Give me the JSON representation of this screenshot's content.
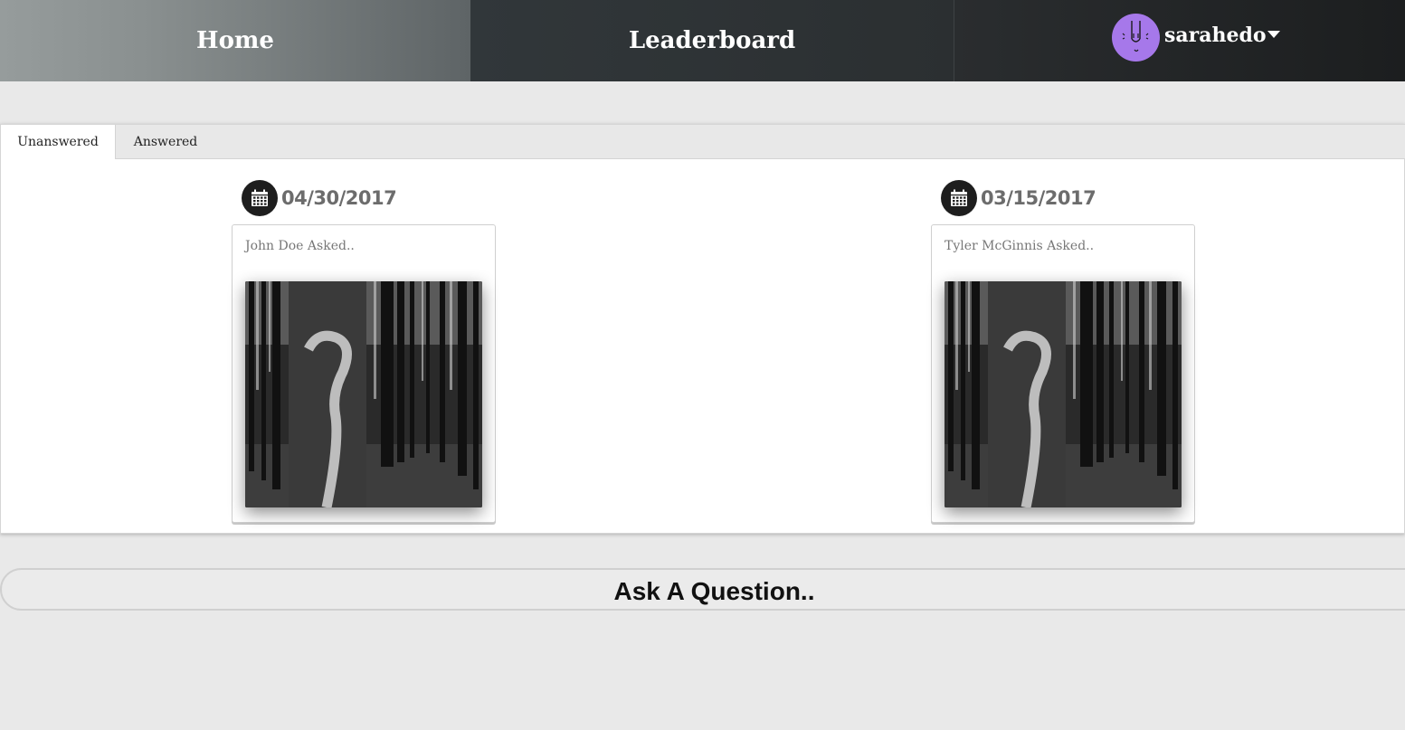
{
  "nav": {
    "home_label": "Home",
    "leaderboard_label": "Leaderboard",
    "username": "sarahedo"
  },
  "tabs": {
    "unanswered_label": "Unanswered",
    "answered_label": "Answered"
  },
  "questions": [
    {
      "date": "04/30/2017",
      "asker": "John Doe Asked.."
    },
    {
      "date": "03/15/2017",
      "asker": "Tyler McGinnis Asked.."
    }
  ],
  "ask_button_label": "Ask A Question..",
  "colors": {
    "avatar": "#a678ea",
    "calendar_circle": "#1e1e1e",
    "page_bg": "#e9e9e9"
  },
  "icons": {
    "calendar": "calendar-icon",
    "dropdown": "caret-down-icon"
  }
}
